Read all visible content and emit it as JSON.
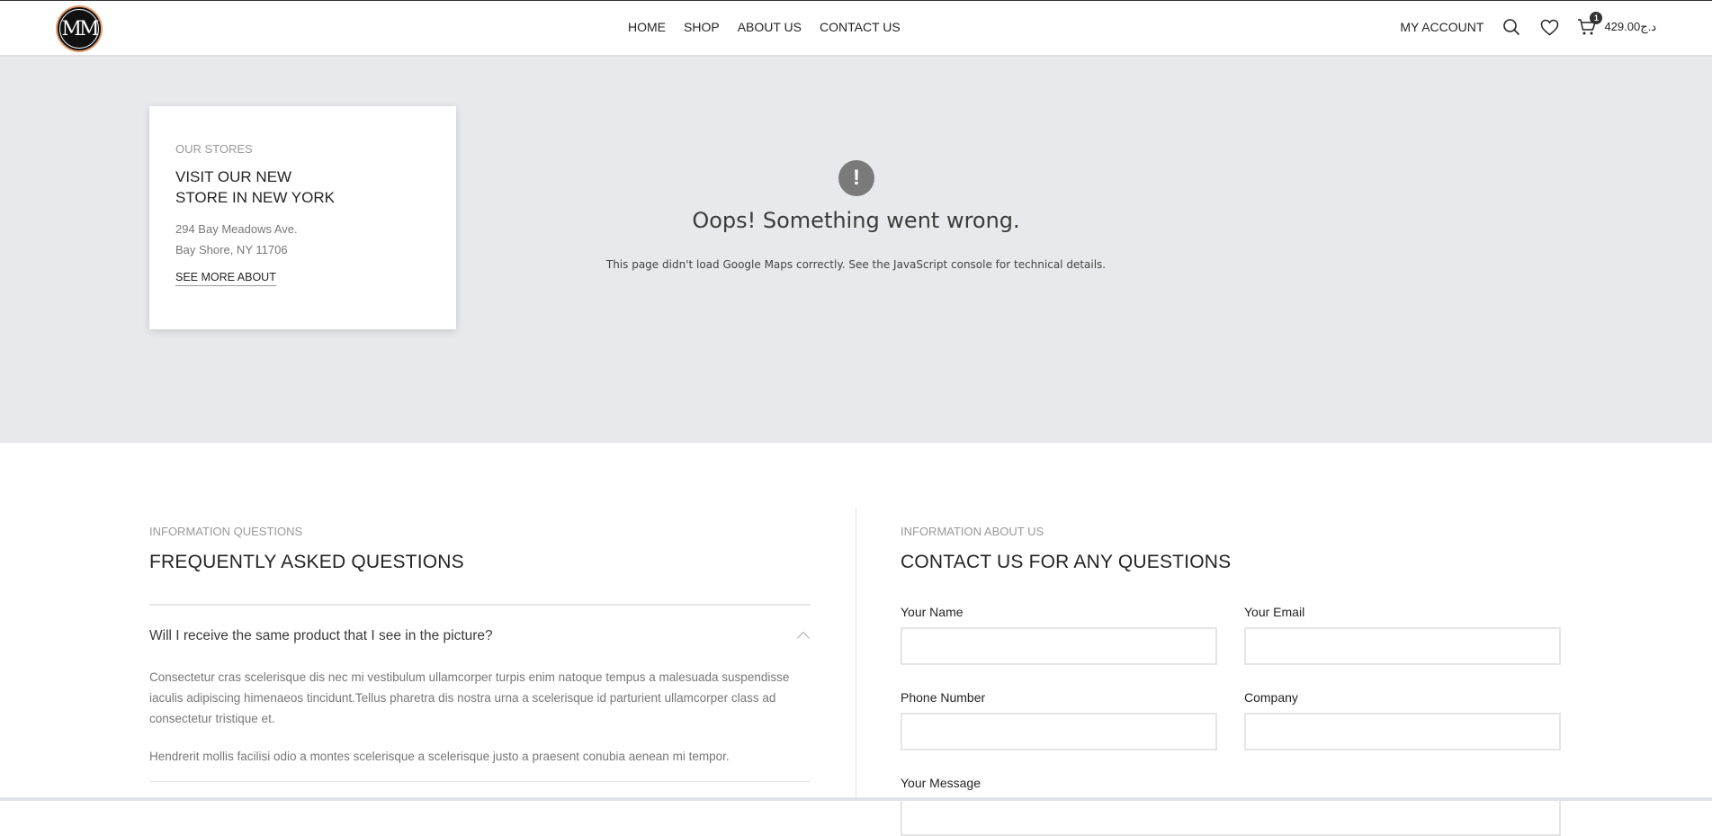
{
  "header": {
    "logo_text": "MM",
    "nav": [
      {
        "label": "HOME"
      },
      {
        "label": "SHOP"
      },
      {
        "label": "ABOUT US"
      },
      {
        "label": "CONTACT US"
      }
    ],
    "my_account": "MY ACCOUNT",
    "cart_count": "1",
    "cart_total": "429.00د.ج"
  },
  "map": {
    "store_card": {
      "subtitle": "OUR STORES",
      "title_line1": "VISIT OUR NEW",
      "title_line2": "STORE IN NEW YORK",
      "address_line1": "294 Bay Meadows Ave.",
      "address_line2": "Bay Shore, NY 11706",
      "link": "SEE MORE ABOUT"
    },
    "error": {
      "icon": "!",
      "title": "Oops! Something went wrong.",
      "description": "This page didn't load Google Maps correctly. See the JavaScript console for technical details."
    }
  },
  "faq": {
    "subtitle": "INFORMATION QUESTIONS",
    "title": "FREQUENTLY ASKED QUESTIONS",
    "question": "Will I receive the same product that I see in the picture?",
    "answer_p1": "Consectetur cras scelerisque dis nec mi vestibulum ullamcorper turpis enim natoque tempus a malesuada suspendisse iaculis adipiscing himenaeos tincidunt.Tellus pharetra dis nostra urna a scelerisque id parturient ullamcorper class ad consectetur tristique et.",
    "answer_p2": "Hendrerit mollis facilisi odio a montes scelerisque a scelerisque justo a praesent conubia aenean mi tempor."
  },
  "contact": {
    "subtitle": "INFORMATION ABOUT US",
    "title": "CONTACT US FOR ANY QUESTIONS",
    "fields": {
      "name_label": "Your Name",
      "email_label": "Your Email",
      "phone_label": "Phone Number",
      "company_label": "Company",
      "message_label": "Your Message"
    }
  }
}
